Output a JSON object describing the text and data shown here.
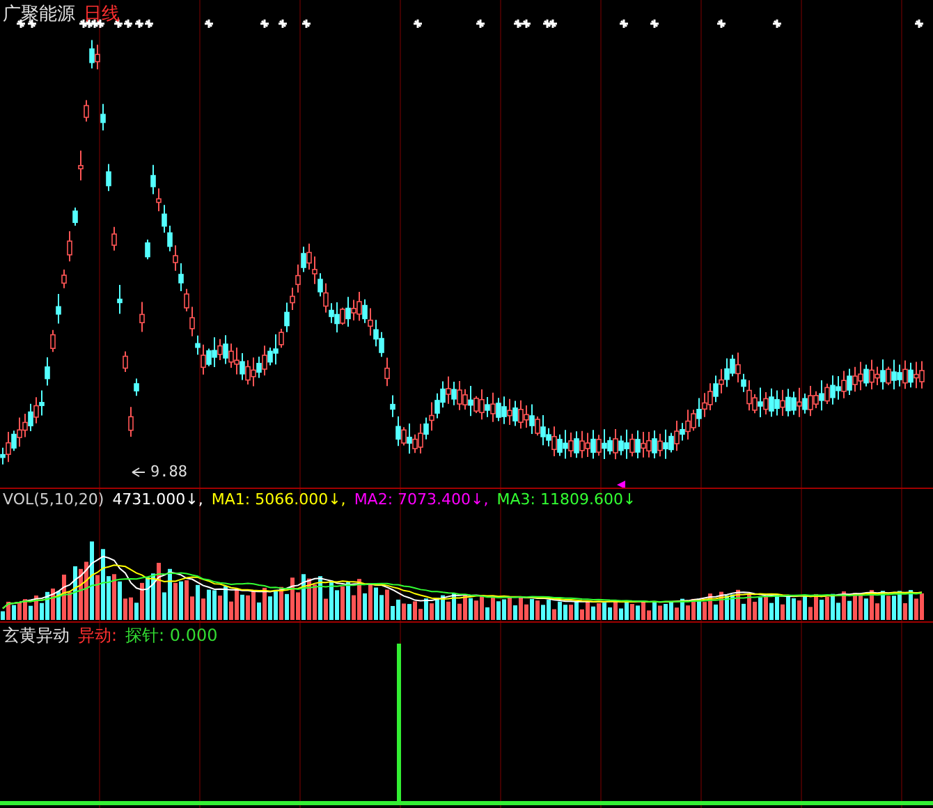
{
  "chart": {
    "stock_name": "广聚能源",
    "period": "日线",
    "low_label": "9.88"
  },
  "volume": {
    "title": "VOL(5,10,20)",
    "values": [
      {
        "text": "4731.000↓,",
        "color": "#ffffff"
      },
      {
        "text": "MA1: 5066.000↓,",
        "color": "#ffff00"
      },
      {
        "text": "MA2: 7073.400↓,",
        "color": "#ff00ff"
      },
      {
        "text": "MA3: 11809.600↓",
        "color": "#33ff33"
      }
    ]
  },
  "indicator": {
    "title": "玄黄异动",
    "items": [
      {
        "text": "异动:",
        "color": "#ff3030"
      },
      {
        "text": "探针: 0.000",
        "color": "#33dd33"
      }
    ]
  }
}
